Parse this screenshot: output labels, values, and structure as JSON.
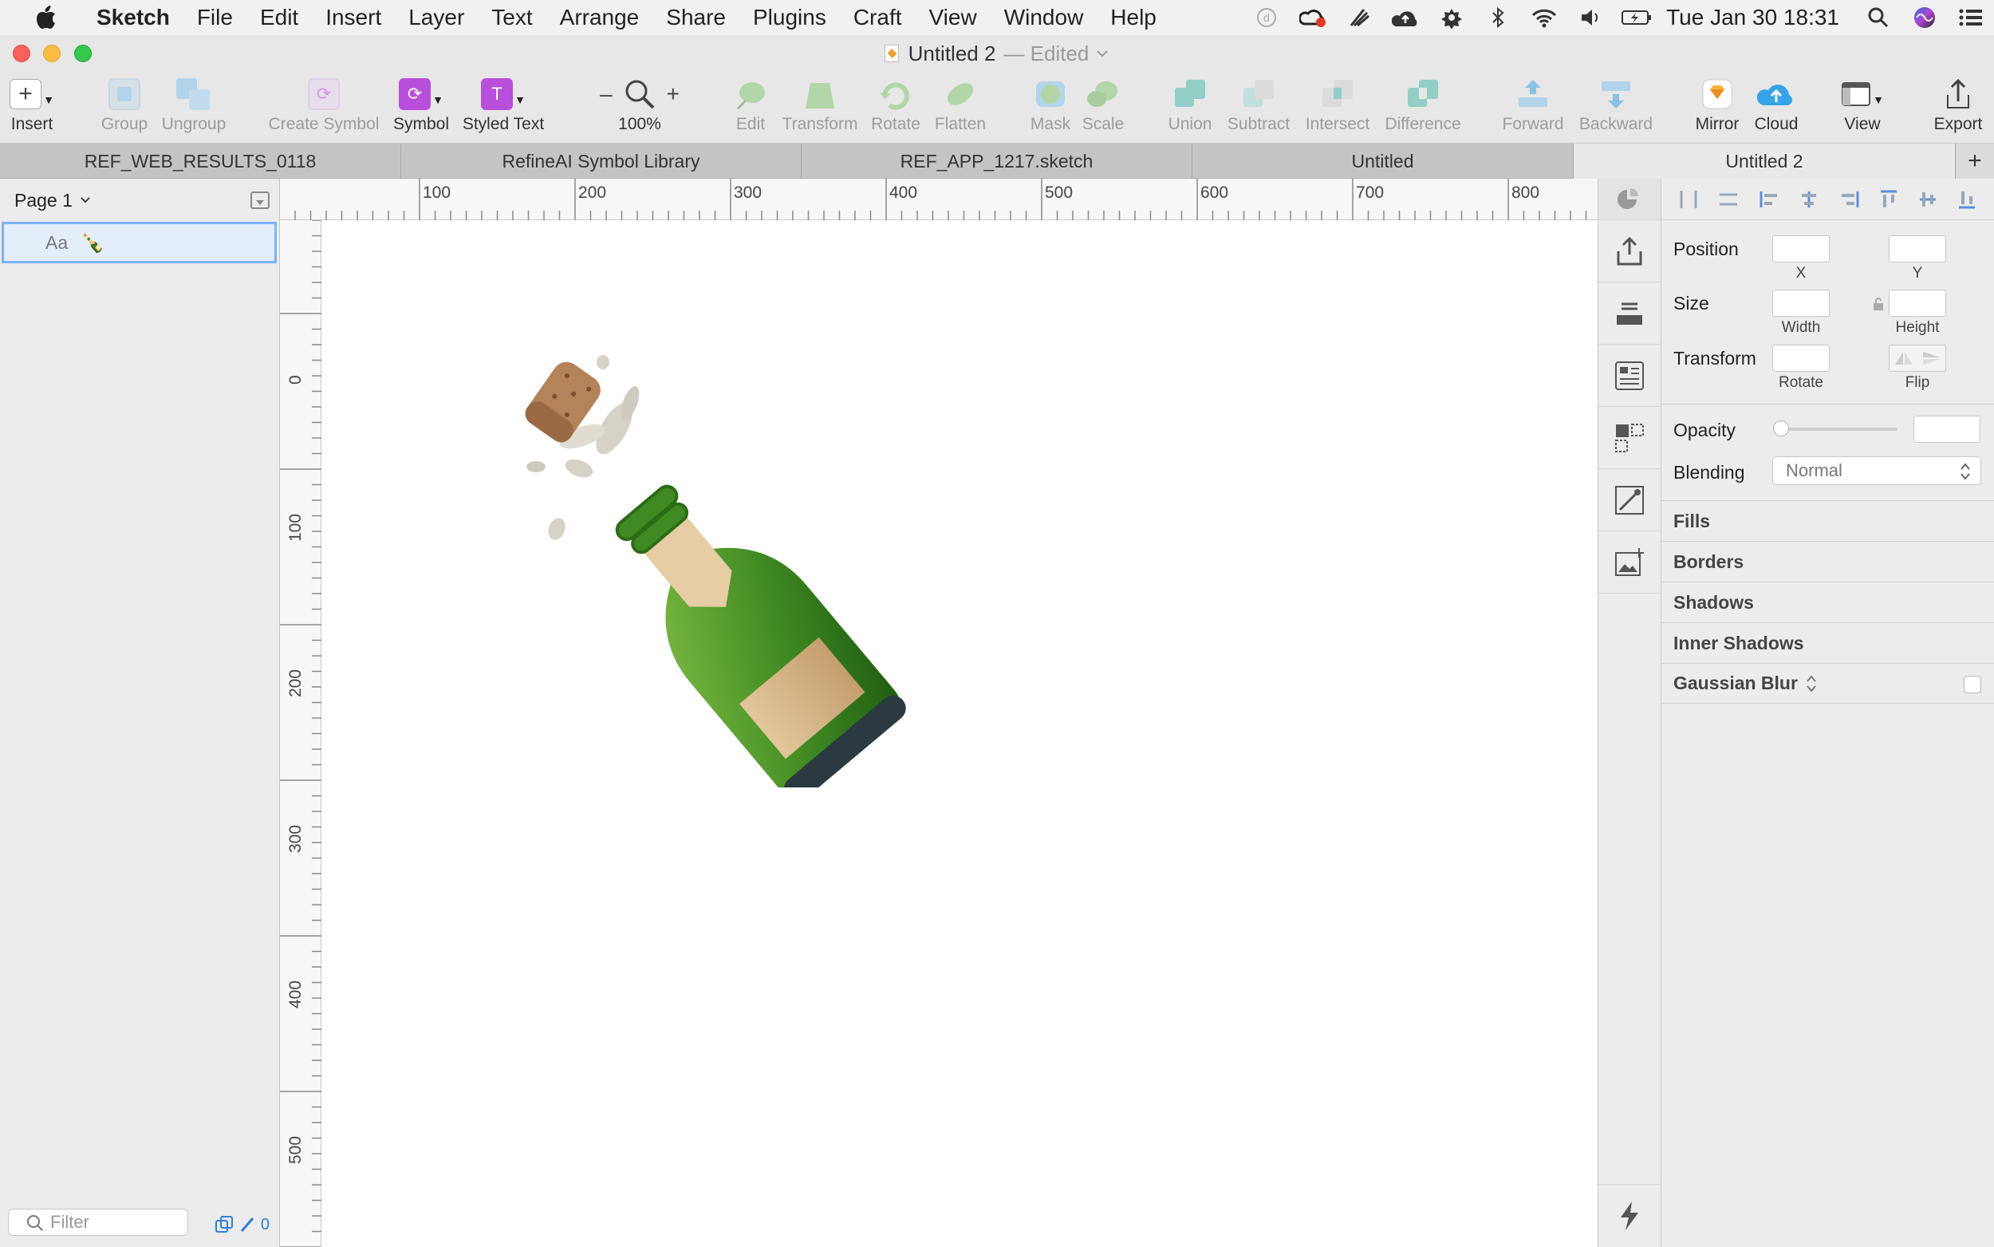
{
  "menubar": {
    "app_name": "Sketch",
    "items": [
      "File",
      "Edit",
      "Insert",
      "Layer",
      "Text",
      "Arrange",
      "Share",
      "Plugins",
      "Craft",
      "View",
      "Window",
      "Help"
    ],
    "clock": "Tue Jan 30  18:31",
    "status_icons": [
      "dropbox-icon",
      "creative-cloud-icon",
      "wacom-icon",
      "cloud-upload-icon",
      "gear-icon",
      "bluetooth-icon",
      "wifi-icon",
      "volume-icon",
      "battery-icon",
      "spotlight-icon",
      "siri-icon",
      "notification-center-icon"
    ]
  },
  "window": {
    "title": "Untitled 2",
    "edited": "— Edited"
  },
  "toolbar": {
    "insert": "Insert",
    "group": "Group",
    "ungroup": "Ungroup",
    "create_symbol": "Create Symbol",
    "symbol": "Symbol",
    "styled_text": "Styled Text",
    "zoom": "100%",
    "zoom_minus": "–",
    "zoom_plus": "+",
    "edit": "Edit",
    "transform": "Transform",
    "rotate": "Rotate",
    "flatten": "Flatten",
    "mask": "Mask",
    "scale": "Scale",
    "union": "Union",
    "subtract": "Subtract",
    "intersect": "Intersect",
    "difference": "Difference",
    "forward": "Forward",
    "backward": "Backward",
    "mirror": "Mirror",
    "cloud": "Cloud",
    "view": "View",
    "export": "Export"
  },
  "tabs": [
    "REF_WEB_RESULTS_0118",
    "RefineAI Symbol Library",
    "REF_APP_1217.sketch",
    "Untitled",
    "Untitled 2"
  ],
  "active_tab": "Untitled 2",
  "tab_add": "+",
  "layers": {
    "page": "Page 1",
    "layer_name": "Aa",
    "layer_emoji": "🍾",
    "filter_placeholder": "Filter",
    "footer_count": "0"
  },
  "ruler": {
    "h_labels": [
      "100",
      "200",
      "300",
      "400",
      "500",
      "600",
      "700",
      "800"
    ],
    "v_labels": [
      "0",
      "100",
      "200",
      "300",
      "400",
      "500"
    ]
  },
  "inspector": {
    "position": "Position",
    "x": "X",
    "y": "Y",
    "size": "Size",
    "width": "Width",
    "height": "Height",
    "transform": "Transform",
    "rotate": "Rotate",
    "flip": "Flip",
    "opacity": "Opacity",
    "blending": "Blending",
    "blending_value": "Normal",
    "fills": "Fills",
    "borders": "Borders",
    "shadows": "Shadows",
    "inner_shadows": "Inner Shadows",
    "gaussian_blur": "Gaussian Blur"
  },
  "colors": {
    "accent": "#2e7de0",
    "symbol_purple": "#b84fdc",
    "selection": "#7ab4f5"
  }
}
